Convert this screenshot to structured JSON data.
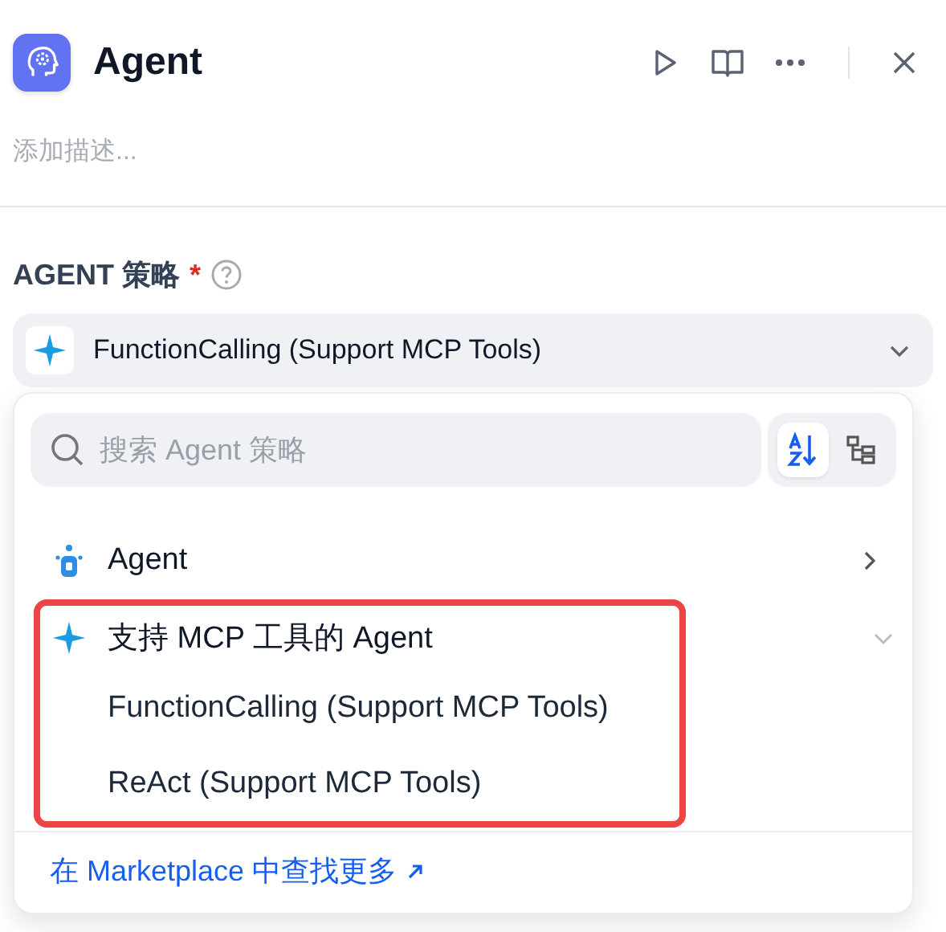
{
  "header": {
    "title": "Agent",
    "description": {
      "placeholder": "添加描述..."
    }
  },
  "strategy": {
    "label": "AGENT 策略",
    "required_mark": "*",
    "value": "FunctionCalling (Support MCP Tools)",
    "open": true
  },
  "menu": {
    "search": {
      "placeholder": "搜索 Agent 策略"
    },
    "view_modes": [
      {
        "kind": "sort",
        "selected": true
      },
      {
        "kind": "tree",
        "selected": false
      }
    ],
    "groups": [
      {
        "name": "Agent",
        "kind": "robot",
        "expanded": false,
        "highlighted": false
      },
      {
        "name": "支持 MCP 工具的 Agent",
        "kind": "sparkle",
        "expanded": true,
        "highlighted": true,
        "options": [
          "FunctionCalling (Support MCP Tools)",
          "ReAct (Support MCP Tools)"
        ]
      }
    ],
    "footer_link": "在 Marketplace 中查找更多"
  }
}
